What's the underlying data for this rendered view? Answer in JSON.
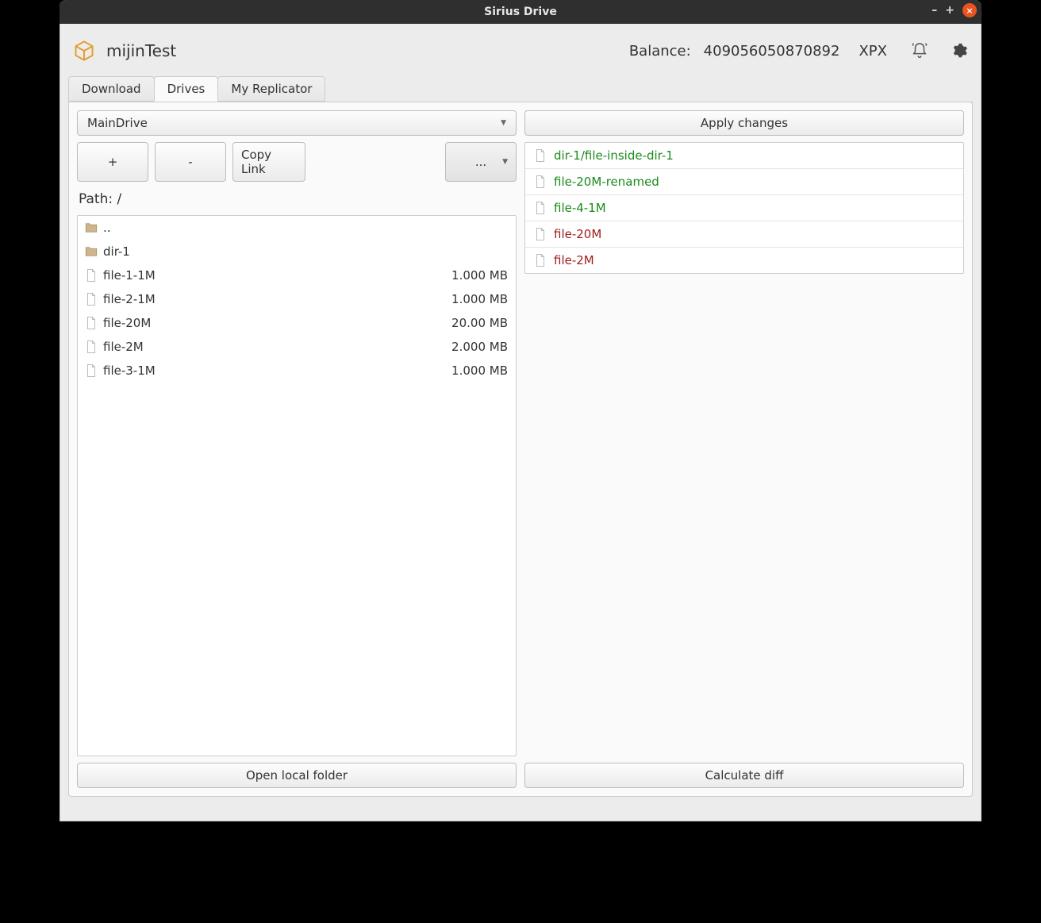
{
  "window": {
    "title": "Sirius Drive"
  },
  "header": {
    "app_name": "mijinTest",
    "balance_label": "Balance:",
    "balance_value": "409056050870892",
    "balance_unit": "XPX"
  },
  "tabs": {
    "download": "Download",
    "drives": "Drives",
    "replicator": "My Replicator"
  },
  "drive_select": {
    "selected": "MainDrive"
  },
  "toolbar": {
    "add": "+",
    "remove": "-",
    "copy_link": "Copy Link",
    "more": "..."
  },
  "path": {
    "label": "Path: /"
  },
  "files": [
    {
      "type": "up",
      "name": "..",
      "size": ""
    },
    {
      "type": "folder",
      "name": "dir-1",
      "size": ""
    },
    {
      "type": "file",
      "name": "file-1-1M",
      "size": "1.000 MB"
    },
    {
      "type": "file",
      "name": "file-2-1M",
      "size": "1.000 MB"
    },
    {
      "type": "file",
      "name": "file-20M",
      "size": "20.00 MB"
    },
    {
      "type": "file",
      "name": "file-2M",
      "size": "2.000 MB"
    },
    {
      "type": "file",
      "name": "file-3-1M",
      "size": "1.000 MB"
    }
  ],
  "apply_changes_label": "Apply changes",
  "changes": [
    {
      "status": "added",
      "name": "dir-1/file-inside-dir-1"
    },
    {
      "status": "added",
      "name": "file-20M-renamed"
    },
    {
      "status": "added",
      "name": "file-4-1M"
    },
    {
      "status": "removed",
      "name": "file-20M"
    },
    {
      "status": "removed",
      "name": "file-2M"
    }
  ],
  "bottom": {
    "open_local": "Open local folder",
    "calc_diff": "Calculate diff"
  }
}
